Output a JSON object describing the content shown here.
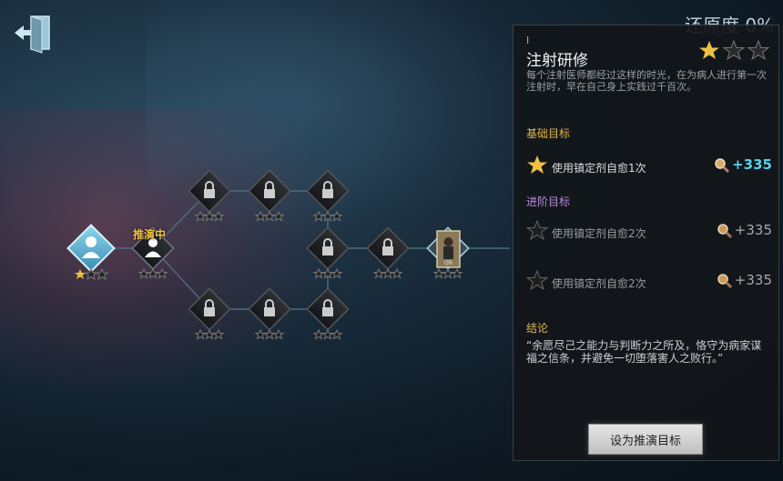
{
  "header": {
    "progress_label": "还原度 0%"
  },
  "tree": {
    "in_progress_tag": "推演中",
    "character_tag": "OR"
  },
  "panel": {
    "number": "I",
    "title": "注射研修",
    "stars_earned": 1,
    "stars_total": 3,
    "description": "每个注射医师都经过这样的时光，在为病人进行第一次注射时，早在自己身上实践过千百次。",
    "basic_label": "基础目标",
    "advanced_label": "进阶目标",
    "conclusion_label": "结论",
    "goals": [
      {
        "text": "使用镇定剂自愈1次",
        "reward": "+335",
        "completed": true
      },
      {
        "text": "使用镇定剂自愈2次",
        "reward": "+335",
        "completed": false
      },
      {
        "text": "使用镇定剂自愈2次",
        "reward": "+335",
        "completed": false
      }
    ],
    "conclusion": "“余愿尽己之能力与判断力之所及，恪守为病家谋福之信条，并避免一切堕落害人之败行。”",
    "set_target_label": "设为推演目标"
  },
  "colors": {
    "gold": "#e0b64a",
    "cyan": "#58d0e8",
    "purple": "#b68bd8"
  }
}
